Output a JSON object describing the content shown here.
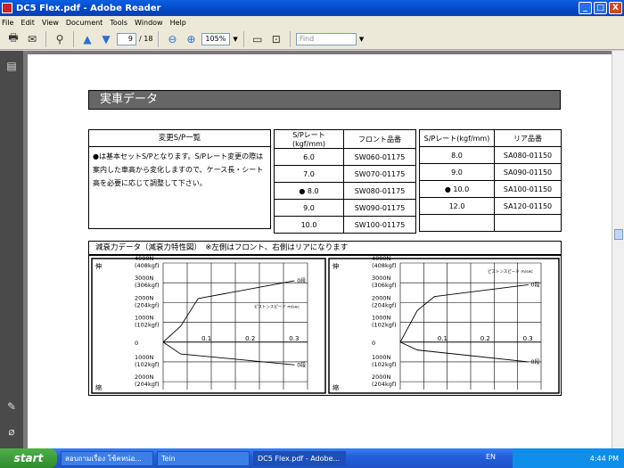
{
  "window": {
    "title": "DC5 Flex.pdf - Adobe Reader",
    "minimize": "_",
    "maximize": "□",
    "close": "X"
  },
  "menu": [
    "File",
    "Edit",
    "View",
    "Document",
    "Tools",
    "Window",
    "Help"
  ],
  "toolbar": {
    "page_current": "9",
    "page_total": "/ 18",
    "zoom": "105%",
    "find_placeholder": "Find"
  },
  "page": {
    "heading": "実車データ",
    "note_header": "変更S/P一覧",
    "note_text": "●は基本セットS/Pとなります。S/Pレート変更の際は案内した車高から変化しますので、ケース長・シート高を必要に応じて調整して下さい。",
    "front_table": {
      "headers": [
        "S/Pレート(kgf/mm)",
        "フロント品番"
      ],
      "rows": [
        {
          "mark": "",
          "rate": "6.0",
          "part": "SW060-01175"
        },
        {
          "mark": "",
          "rate": "7.0",
          "part": "SW070-01175"
        },
        {
          "mark": "●",
          "rate": "8.0",
          "part": "SW080-01175"
        },
        {
          "mark": "",
          "rate": "9.0",
          "part": "SW090-01175"
        },
        {
          "mark": "",
          "rate": "10.0",
          "part": "SW100-01175"
        }
      ]
    },
    "rear_table": {
      "headers": [
        "S/Pレート(kgf/mm)",
        "リア品番"
      ],
      "rows": [
        {
          "mark": "",
          "rate": "8.0",
          "part": "SA080-01150"
        },
        {
          "mark": "",
          "rate": "9.0",
          "part": "SA090-01150"
        },
        {
          "mark": "●",
          "rate": "10.0",
          "part": "SA100-01150"
        },
        {
          "mark": "",
          "rate": "12.0",
          "part": "SA120-01150"
        },
        {
          "mark": "",
          "rate": "",
          "part": ""
        }
      ]
    },
    "chart_section_title": "減衰力データ（減衰力特性図）　※左側はフロント、右側はリアになります"
  },
  "chart_data": [
    {
      "type": "line",
      "name": "front",
      "y_axis_top_label": "伸",
      "y_axis_bottom_label": "縮",
      "y_ticks": [
        {
          "value": 4000,
          "label": "4000N",
          "sub": "(408kgf)"
        },
        {
          "value": 3000,
          "label": "3000N",
          "sub": "(306kgf)"
        },
        {
          "value": 2000,
          "label": "2000N",
          "sub": "(204kgf)"
        },
        {
          "value": 1000,
          "label": "1000N",
          "sub": "(102kgf)"
        },
        {
          "value": 0,
          "label": "0",
          "sub": ""
        },
        {
          "value": -1000,
          "label": "1000N",
          "sub": "(102kgf)"
        },
        {
          "value": -2000,
          "label": "2000N",
          "sub": "(204kgf)"
        }
      ],
      "x_ticks": [
        0.1,
        0.2,
        0.3
      ],
      "xlim": [
        0,
        0.33
      ],
      "ylim": [
        -2400,
        4000
      ],
      "x_unit_label": "ピストンスピード m/sec",
      "series": [
        {
          "name": "0段",
          "points": [
            [
              0,
              0
            ],
            [
              0.04,
              800
            ],
            [
              0.08,
              2200
            ],
            [
              0.3,
              3100
            ]
          ]
        },
        {
          "name": "0段",
          "points": [
            [
              0,
              0
            ],
            [
              0.04,
              -600
            ],
            [
              0.3,
              -1150
            ]
          ]
        }
      ]
    },
    {
      "type": "line",
      "name": "rear",
      "y_axis_top_label": "伸",
      "y_axis_bottom_label": "縮",
      "y_ticks": [
        {
          "value": 4000,
          "label": "4000N",
          "sub": "(408kgf)"
        },
        {
          "value": 3000,
          "label": "3000N",
          "sub": "(306kgf)"
        },
        {
          "value": 2000,
          "label": "2000N",
          "sub": "(204kgf)"
        },
        {
          "value": 1000,
          "label": "1000N",
          "sub": "(102kgf)"
        },
        {
          "value": 0,
          "label": "0",
          "sub": ""
        },
        {
          "value": -1000,
          "label": "1000N",
          "sub": "(102kgf)"
        },
        {
          "value": -2000,
          "label": "2000N",
          "sub": "(204kgf)"
        }
      ],
      "x_ticks": [
        0.1,
        0.2,
        0.3
      ],
      "xlim": [
        0,
        0.33
      ],
      "ylim": [
        -2400,
        4000
      ],
      "x_unit_label": "ピストンスピード m/sec",
      "series": [
        {
          "name": "0段",
          "points": [
            [
              0,
              0
            ],
            [
              0.04,
              1600
            ],
            [
              0.08,
              2300
            ],
            [
              0.3,
              2900
            ]
          ]
        },
        {
          "name": "0段",
          "points": [
            [
              0,
              0
            ],
            [
              0.04,
              -400
            ],
            [
              0.3,
              -1000
            ]
          ]
        }
      ]
    }
  ],
  "taskbar": {
    "start": "start",
    "items": [
      "สอบถามเรื่อง โช้คหน่อ...",
      "Tein",
      "DC5 Flex.pdf - Adobe..."
    ],
    "lang": "EN",
    "clock": "4:44 PM"
  },
  "colors": {
    "titlebar": "#0a5fe0",
    "heading_bar": "#666666",
    "taskbar": "#245edb",
    "start": "#2e8c2a"
  }
}
